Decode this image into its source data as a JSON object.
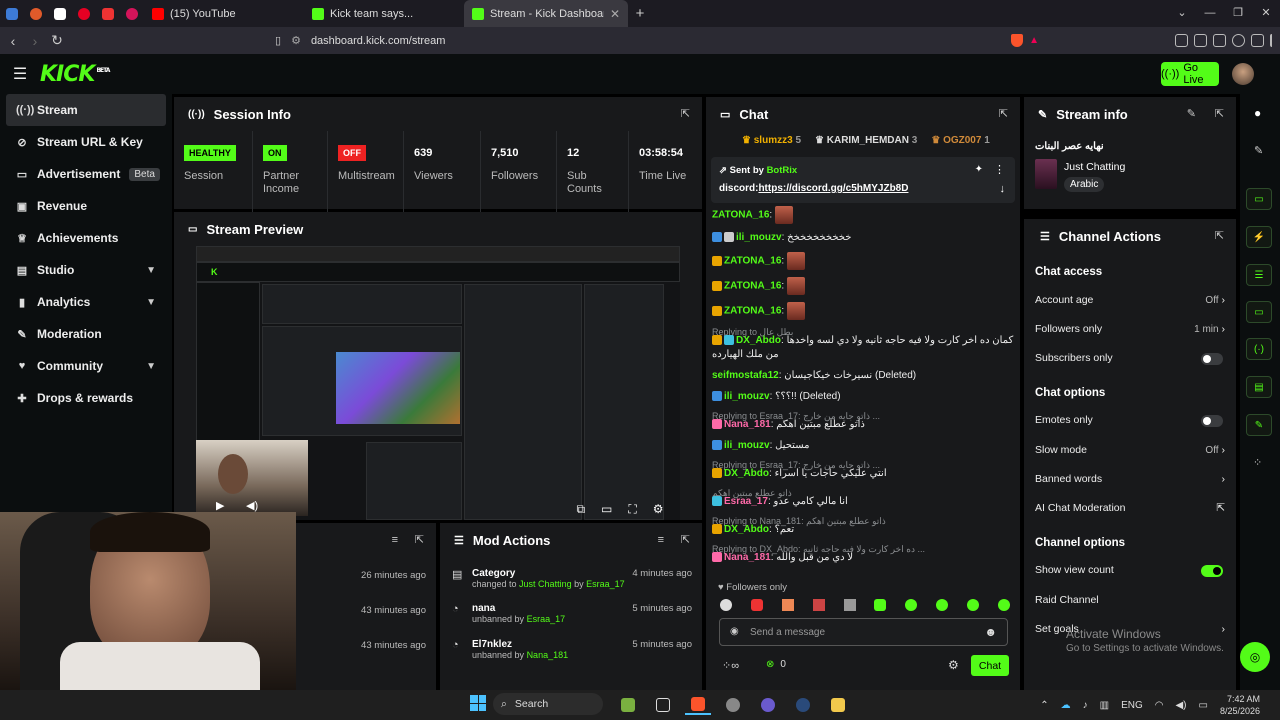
{
  "browser": {
    "tabs": [
      {
        "title": "(15) YouTube",
        "fav_color": "#ff0000"
      },
      {
        "title": "Kick team says...",
        "fav_color": "#53fc18"
      },
      {
        "title": "Stream - Kick Dashboard",
        "fav_color": "#53fc18"
      }
    ],
    "url": "dashboard.kick.com/stream",
    "new_tab": "+"
  },
  "header": {
    "logo": "KICK",
    "logo_badge": "BETA",
    "go_live": "Go Live"
  },
  "sidebar": {
    "items": [
      {
        "label": "Stream",
        "icon": "broadcast-icon"
      },
      {
        "label": "Stream URL & Key",
        "icon": "link-icon"
      },
      {
        "label": "Advertisement",
        "icon": "monitor-icon",
        "badge": "Beta"
      },
      {
        "label": "Revenue",
        "icon": "wallet-icon"
      },
      {
        "label": "Achievements",
        "icon": "trophy-icon"
      },
      {
        "label": "Studio",
        "icon": "studio-icon"
      },
      {
        "label": "Analytics",
        "icon": "chart-icon"
      },
      {
        "label": "Moderation",
        "icon": "wrench-icon"
      },
      {
        "label": "Community",
        "icon": "community-icon"
      },
      {
        "label": "Drops & rewards",
        "icon": "gift-icon"
      }
    ]
  },
  "session": {
    "title": "Session Info",
    "cells": [
      {
        "value": "HEALTHY",
        "label": "Session"
      },
      {
        "value": "ON",
        "label": "Partner Income"
      },
      {
        "value": "OFF",
        "label": "Multistream"
      },
      {
        "value": "639",
        "label": "Viewers"
      },
      {
        "value": "7,510",
        "label": "Followers"
      },
      {
        "value": "12",
        "label": "Sub Counts"
      },
      {
        "value": "03:58:54",
        "label": "Time Live"
      }
    ]
  },
  "preview": {
    "title": "Stream Preview"
  },
  "mod": {
    "title": "Mod Actions",
    "rows": [
      {
        "title": "Category",
        "sub_pre": "changed to ",
        "sub_hl": "Just Chatting",
        "sub_mid": " by ",
        "sub_user": "Esraa_17",
        "time": "4 minutes ago"
      },
      {
        "title": "nana",
        "sub_pre": "unbanned by ",
        "sub_hl": "",
        "sub_mid": "",
        "sub_user": "Esraa_17",
        "time": "5 minutes ago"
      },
      {
        "title": "El7nklez",
        "sub_pre": "unbanned by ",
        "sub_hl": "",
        "sub_mid": "",
        "sub_user": "Nana_181",
        "time": "5 minutes ago"
      }
    ],
    "left_times": [
      "26 minutes ago",
      "43 minutes ago",
      "43 minutes ago"
    ]
  },
  "chat": {
    "title": "Chat",
    "top_gifters": [
      {
        "name": "slumzz3",
        "count": "5"
      },
      {
        "name": "KARIM_HEMDAN",
        "count": "3"
      },
      {
        "name": "OGZ007",
        "count": "1"
      }
    ],
    "pinned": {
      "sent_by": "Sent by",
      "sender": "BotRix",
      "prefix": "discord:",
      "link": "https://discord.gg/c5hMYJZb8D"
    },
    "messages": [
      {
        "user": "ZATONA_16",
        "color": "#53fc18",
        "text": "",
        "emote": true
      },
      {
        "user": "ili_mouzv",
        "color": "#53fc18",
        "text": "خخخخخخخخخخ"
      },
      {
        "user": "ZATONA_16",
        "color": "#53fc18",
        "text": "",
        "emote": true
      },
      {
        "user": "ZATONA_16",
        "color": "#53fc18",
        "text": "",
        "emote": true
      },
      {
        "user": "ZATONA_16",
        "color": "#53fc18",
        "text": "",
        "emote": true
      },
      {
        "reply": "Replying to بطل عال",
        "user": "DX_Abdo",
        "color": "#53fc18",
        "text": "كمان ده اخر كارت ولا فيه حاجه ثانيه ولا دي لسه واخدها من ملك الهيارده"
      },
      {
        "user": "seifmostafa12",
        "color": "#53fc18",
        "text": "نسيرخات خيكاجيسان (Deleted)"
      },
      {
        "user": "ili_mouzv",
        "color": "#53fc18",
        "text": "؟؟؟!! (Deleted)"
      },
      {
        "reply": "Replying to Esraa_17: ذاتو جايه من خارج ...",
        "user": "Nana_181",
        "color": "#ff6aa9",
        "text": "ذاتو عطلع مبتين اهكم"
      },
      {
        "user": "ili_mouzv",
        "color": "#53fc18",
        "text": "مستحيل"
      },
      {
        "reply": "Replying to Esraa_17: ذاتو جايه من خارج ...",
        "user": "DX_Abdo",
        "color": "#53fc18",
        "text": "انتي عليكي حاجات يا اسراء"
      },
      {
        "reply": "ذاتو عطلع مبتين اهكم",
        "user": "Esraa_17",
        "color": "#ff6aa9",
        "text": "انا مالي كامي عدو"
      },
      {
        "reply": "Replying to Nana_181: ذاتو عطلع مبتين اهكم",
        "user": "DX_Abdo",
        "color": "#53fc18",
        "text": "تعم؟"
      },
      {
        "reply": "Replying to DX_Abdo: ده اخر كارت ولا فيه حاجه ثانيه ...",
        "user": "Nana_181",
        "color": "#ff6aa9",
        "text": "لا دي من قبل والله"
      }
    ],
    "followers_only": "Followers only",
    "placeholder": "Send a message",
    "send": "Chat",
    "points": "0"
  },
  "stream_info": {
    "title": "Stream info",
    "stream_title": "نهايه عصر البنات",
    "category": "Just Chatting",
    "language": "Arabic"
  },
  "channel_actions": {
    "title": "Channel Actions",
    "chat_access": "Chat access",
    "account_age": {
      "label": "Account age",
      "value": "Off"
    },
    "followers_only": {
      "label": "Followers only",
      "value": "1 min"
    },
    "subscribers_only": "Subscribers only",
    "chat_options": "Chat options",
    "emotes_only": "Emotes only",
    "slow_mode": {
      "label": "Slow mode",
      "value": "Off"
    },
    "banned_words": "Banned words",
    "ai_moderation": "AI Chat Moderation",
    "channel_options": "Channel options",
    "show_view_count": "Show view count",
    "raid_channel": "Raid Channel",
    "set_goals": "Set goals"
  },
  "activate": {
    "line1": "Activate Windows",
    "line2": "Go to Settings to activate Windows."
  },
  "taskbar": {
    "search": "Search",
    "lang": "ENG",
    "time": "7:42 AM",
    "date": "8/25/2026"
  }
}
